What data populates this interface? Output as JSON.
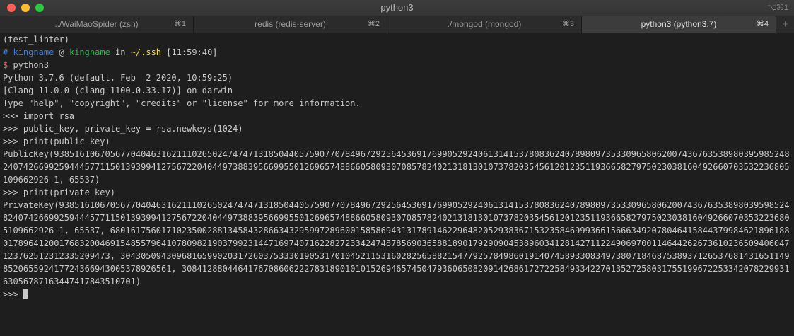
{
  "window": {
    "title": "python3",
    "shortcut": "⌥⌘1"
  },
  "tabs": [
    {
      "label": "../WaiMaoSpider (zsh)",
      "key": "⌘1"
    },
    {
      "label": "redis (redis-server)",
      "key": "⌘2"
    },
    {
      "label": "./mongod (mongod)",
      "key": "⌘3"
    },
    {
      "label": "python3 (python3.7)",
      "key": "⌘4",
      "active": true
    }
  ],
  "new_tab_label": "+",
  "prompt": {
    "venv": "(test_linter)",
    "hash": "#",
    "user": "kingname",
    "at": "@",
    "host": "kingname",
    "in": "in",
    "path": "~/.ssh",
    "time": "[11:59:40]",
    "dollar": "$",
    "command": "python3"
  },
  "output": {
    "python_version": "Python 3.7.6 (default, Feb  2 2020, 10:59:25)",
    "clang": "[Clang 11.0.0 (clang-1100.0.33.17)] on darwin",
    "help": "Type \"help\", \"copyright\", \"credits\" or \"license\" for more information.",
    "cmd1": ">>> import rsa",
    "cmd2": ">>> public_key, private_key = rsa.newkeys(1024)",
    "cmd3": ">>> print(public_key)",
    "public_key": "PublicKey(9385161067056770404631621110265024747471318504405759077078496729256453691769905292406131415378083624078980973533096580620074367635389803959852482407426699259444577115013939941275672204044973883956699550126965748866058093070857824021318130107378203545612012351193665827975023038160492660703532236805109662926 1, 65537)",
    "cmd4": ">>> print(private_key)",
    "private_key": "PrivateKey(9385161067056770404631621110265024747471318504405759077078496729256453691769905292406131415378083624078980973533096580620074367635389803959852482407426699259444577115013939941275672204044973883956699550126965748866058093070857824021318130107378203545612012351193665827975023038160492660703532236805109662926 1, 65537, 68016175601710235002881345843286634329599728960015858694313178914622964820529383671532358469993661566634920780464158443799846218961880178964120017683200469154855796410780982190379923144716974071622827233424748785690365881890179290904538960341281427112249069700114644262673610236509406047123762512312335209473, 30430509430968165990203172603753330190531701045211531602825658821547792578498601914074589330834973807184687538937126537681431651149852065592417724366943005378926561, 3084128804464176708606222783189010101526946574504793606508209142686172722584933422701352725803175519967225334207822993163056787163447417843510701)",
    "prompt_end": ">>> "
  }
}
